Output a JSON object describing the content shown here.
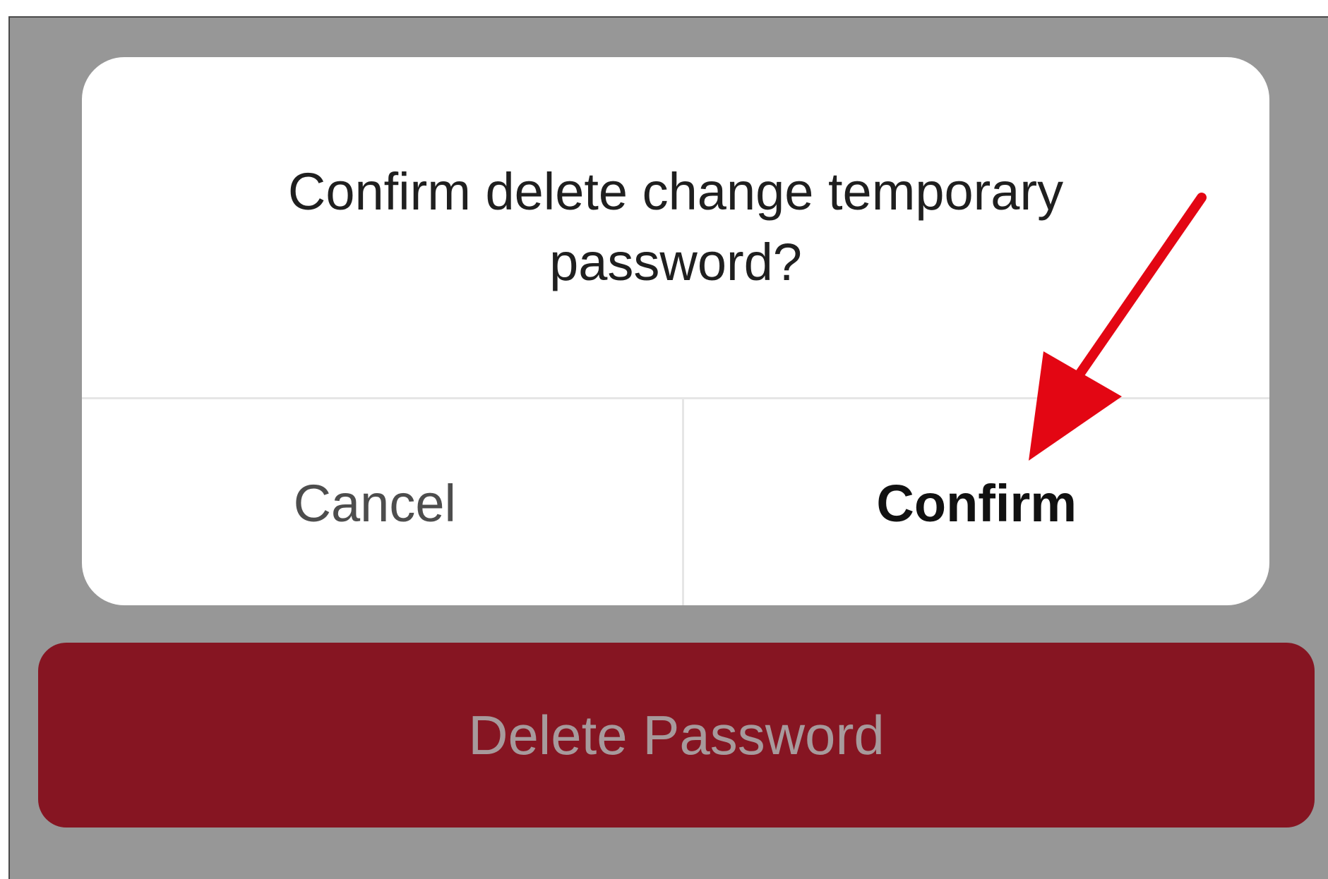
{
  "dialog": {
    "message": "Confirm delete change temporary password?",
    "cancel_label": "Cancel",
    "confirm_label": "Confirm"
  },
  "main": {
    "delete_button_label": "Delete Password"
  },
  "colors": {
    "overlay": "#979797",
    "delete_button_bg": "#861522",
    "delete_button_text": "#a79a9c",
    "annotation_arrow": "#e30613"
  },
  "annotation": {
    "icon": "red-arrow-icon",
    "points_to": "Confirm"
  }
}
